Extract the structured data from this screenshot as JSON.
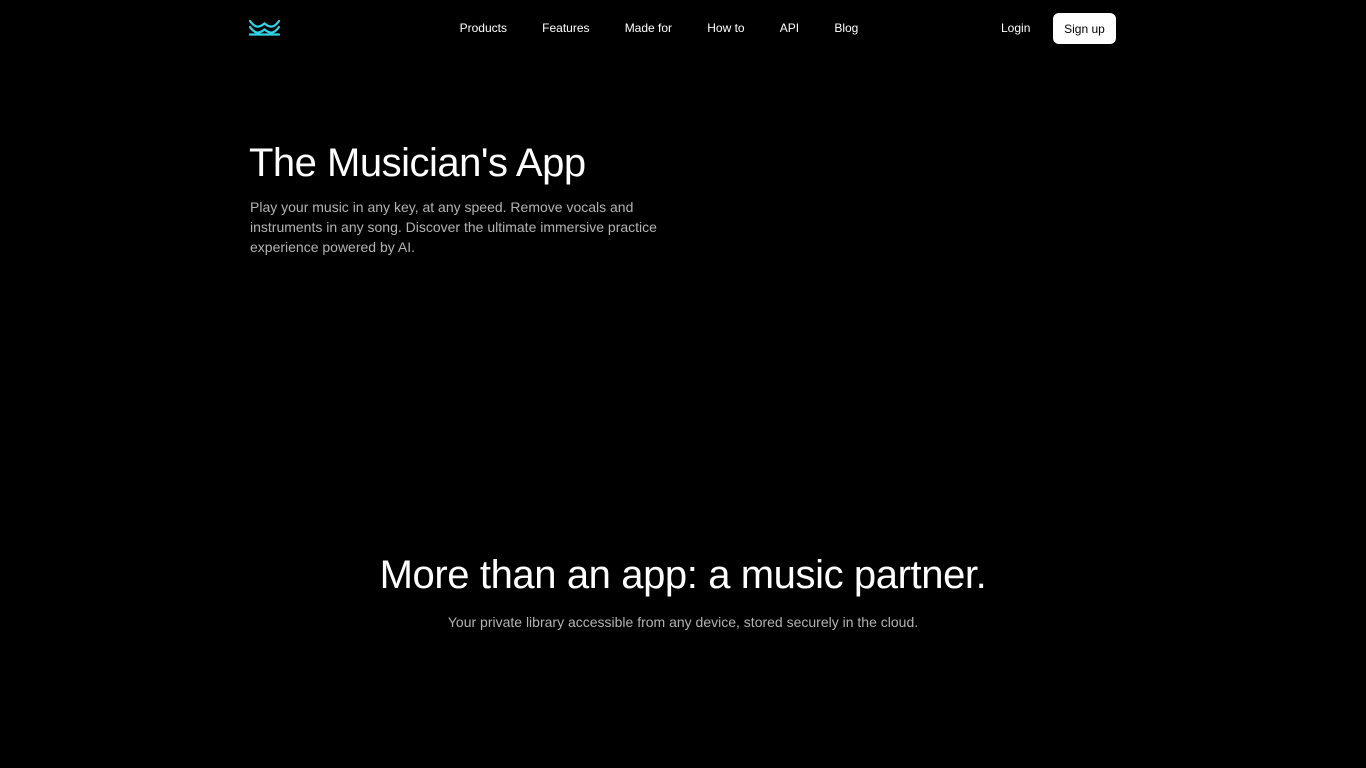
{
  "brand": {
    "logo_icon": "waves-logo-icon",
    "accent_color": "#2fd6e8"
  },
  "nav": {
    "links": [
      "Products",
      "Features",
      "Made for",
      "How to",
      "API",
      "Blog"
    ],
    "login_label": "Login",
    "signup_label": "Sign up"
  },
  "hero": {
    "title": "The Musician's App",
    "subtitle": "Play your music in any key, at any speed. Remove vocals and instruments in any song. Discover the ultimate immersive practice experience powered by AI."
  },
  "section": {
    "title": "More than an app: a music partner.",
    "subtitle": "Your private library accessible from any device, stored securely in the cloud."
  }
}
